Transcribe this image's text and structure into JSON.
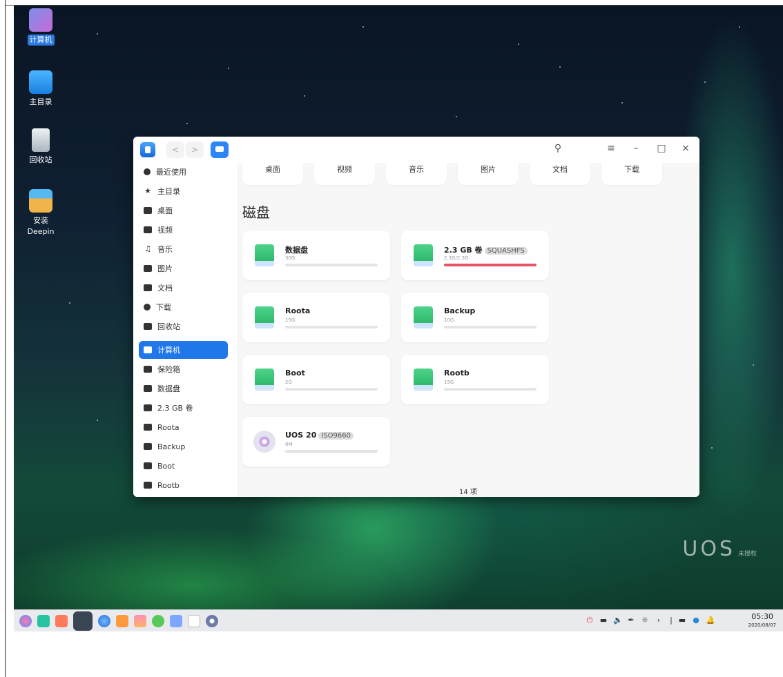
{
  "desktop": {
    "icons": [
      {
        "label": "计算机"
      },
      {
        "label": "主目录"
      },
      {
        "label": "回收站"
      },
      {
        "label": "安装\nDeepin",
        "line1": "安装",
        "line2": "Deepin"
      }
    ],
    "watermark": {
      "brand": "UOS",
      "note": "未授权"
    }
  },
  "window": {
    "sidebar": {
      "items": [
        {
          "label": "最近使用",
          "icon": "clock-icon"
        },
        {
          "label": "主目录",
          "icon": "home-icon"
        },
        {
          "label": "桌面",
          "icon": "desktop-icon"
        },
        {
          "label": "视频",
          "icon": "video-icon"
        },
        {
          "label": "音乐",
          "icon": "music-icon"
        },
        {
          "label": "图片",
          "icon": "picture-icon"
        },
        {
          "label": "文档",
          "icon": "document-icon"
        },
        {
          "label": "下载",
          "icon": "download-icon"
        },
        {
          "label": "回收站",
          "icon": "trash-icon"
        },
        {
          "label": "计算机",
          "icon": "computer-icon",
          "active": true
        },
        {
          "label": "保险箱",
          "icon": "vault-icon"
        },
        {
          "label": "数据盘",
          "icon": "disk-icon"
        },
        {
          "label": "2.3 GB 卷",
          "icon": "disk-icon"
        },
        {
          "label": "Roota",
          "icon": "disk-icon"
        },
        {
          "label": "Backup",
          "icon": "disk-icon"
        },
        {
          "label": "Boot",
          "icon": "disk-icon"
        },
        {
          "label": "Rootb",
          "icon": "disk-icon"
        }
      ]
    },
    "quick_access": [
      "桌面",
      "视频",
      "音乐",
      "图片",
      "文档",
      "下载"
    ],
    "section_title": "磁盘",
    "disks": [
      {
        "name": "数据盘",
        "tag": "",
        "size": "30G",
        "used_fraction": 0
      },
      {
        "name": "2.3 GB 卷",
        "tag": "SQUASHFS",
        "size": "2.3G/2.3G",
        "used_fraction": 1
      },
      {
        "name": "Roota",
        "tag": "",
        "size": "15G",
        "used_fraction": 0
      },
      {
        "name": "Backup",
        "tag": "",
        "size": "10G",
        "used_fraction": 0
      },
      {
        "name": "Boot",
        "tag": "",
        "size": "2G",
        "used_fraction": 0
      },
      {
        "name": "Rootb",
        "tag": "",
        "size": "15G",
        "used_fraction": 0
      },
      {
        "name": "UOS 20",
        "tag": "ISO9660",
        "size": "0M",
        "used_fraction": 0,
        "type": "optical"
      }
    ],
    "status": "14 项"
  },
  "taskbar": {
    "time": "05:30",
    "date": "2020/08/07"
  }
}
